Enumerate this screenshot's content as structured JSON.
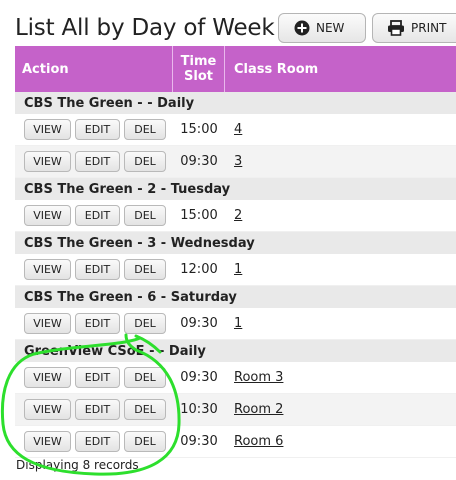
{
  "header": {
    "title": "List All by Day of Week",
    "new_label": "NEW",
    "print_label": "PRINT"
  },
  "table": {
    "columns": [
      "Action",
      "Time",
      "Slot",
      "Class Room"
    ],
    "row_buttons": {
      "view": "VIEW",
      "edit": "EDIT",
      "del": "DEL"
    },
    "groups": [
      {
        "title": "CBS The Green -  - Daily",
        "rows": [
          {
            "time": "15:00",
            "room": "4"
          },
          {
            "time": "09:30",
            "room": "3"
          }
        ]
      },
      {
        "title": "CBS The Green - 2 - Tuesday",
        "rows": [
          {
            "time": "15:00",
            "room": "2"
          }
        ]
      },
      {
        "title": "CBS The Green - 3 - Wednesday",
        "rows": [
          {
            "time": "12:00",
            "room": "1"
          }
        ]
      },
      {
        "title": "CBS The Green - 6 - Saturday",
        "rows": [
          {
            "time": "09:30",
            "room": "1"
          }
        ]
      },
      {
        "title": "GreenView CSoE -  - Daily",
        "rows": [
          {
            "time": "09:30",
            "room": "Room 3"
          },
          {
            "time": "10:30",
            "room": "Room 2"
          },
          {
            "time": "09:30",
            "room": "Room 6"
          }
        ]
      }
    ]
  },
  "footer": {
    "records_text": "Displaying 8 records"
  },
  "colors": {
    "header_bg": "#c562c9",
    "group_bg": "#e9e9e9",
    "annotation": "#2ddf2d"
  },
  "icons": {
    "new": "plus-circle-icon",
    "print": "printer-icon"
  }
}
